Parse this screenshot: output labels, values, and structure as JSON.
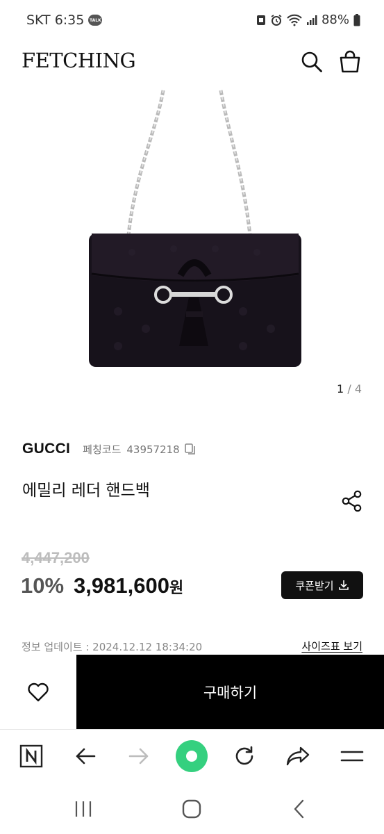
{
  "status_bar": {
    "carrier_time": "SKT 6:35",
    "talk_badge": "TALK",
    "battery": "88%"
  },
  "header": {
    "logo": "FETCHING",
    "icons": [
      "search-icon",
      "shopping-bag-icon"
    ]
  },
  "gallery": {
    "current": "1",
    "separator": "/",
    "total": "4"
  },
  "product": {
    "brand": "GUCCI",
    "code_label": "페칭코드",
    "code": "43957218",
    "name": "에밀리 레더 핸드백",
    "original_price": "4,447,200",
    "discount": "10%",
    "sale_price": "3,981,600",
    "currency": "원",
    "coupon_label": "쿠폰받기",
    "update_info": "정보 업데이트 : 2024.12.12 18:34:20",
    "size_chart_link": "사이즈표 보기"
  },
  "purchase_bar": {
    "buy_label": "구매하기"
  },
  "browser_toolbar": {
    "icons": [
      "naver-n-icon",
      "back-arrow-icon",
      "forward-arrow-icon",
      "home-icon",
      "refresh-icon",
      "share-arrow-icon",
      "menu-icon"
    ],
    "home_color": "#35d07f"
  },
  "nav_bar": {
    "icons": [
      "recent-apps-icon",
      "home-button-icon",
      "back-button-icon"
    ]
  }
}
